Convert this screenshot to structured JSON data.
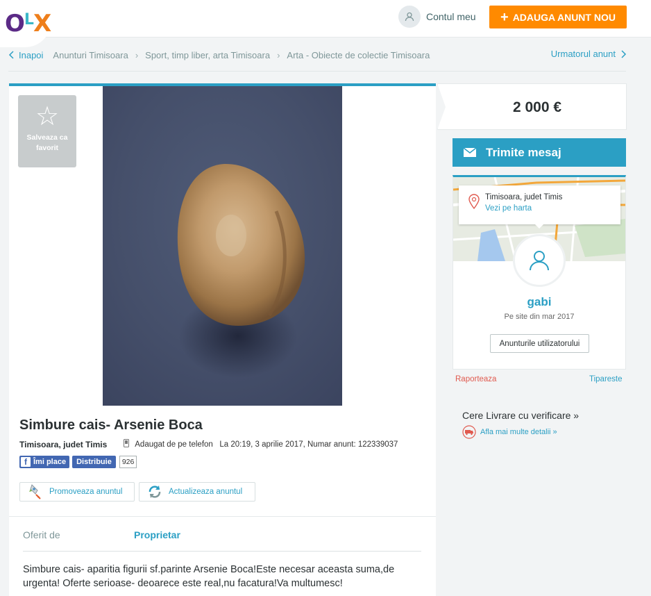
{
  "header": {
    "logo": "OLX",
    "account_label": "Contul meu",
    "add_button_label": "ADAUGA ANUNT NOU",
    "add_button_icon": "plus-icon"
  },
  "breadcrumb": {
    "back_label": "Inapoi",
    "items": [
      "Anunturi Timisoara",
      "Sport, timp liber, arta Timisoara",
      "Arta - Obiecte de colectie Timisoara"
    ],
    "next_label": "Urmatorul anunt"
  },
  "ad": {
    "favorite_label": "Salveaza ca favorit",
    "title": "Simbure cais- Arsenie Boca",
    "location": "Timisoara, judet Timis",
    "added_text": "Adaugat de pe telefon   La 20:19, 3 aprilie 2017, Numar anunt: 122339037",
    "fb_like_label": "Îmi place",
    "fb_share_label": "Distribuie",
    "share_count": "926",
    "promote_label": "Promoveaza anuntul",
    "refresh_label": "Actualizeaza anuntul",
    "offered_by_key": "Oferit de",
    "offered_by_value": "Proprietar",
    "description": "Simbure cais- aparitia figurii sf.parinte Arsenie Boca!Este necesar aceasta suma,de urgenta! Oferte serioase- deoarece este real,nu facatura!Va multumesc!"
  },
  "sidebar": {
    "price": "2 000 €",
    "message_button_label": "Trimite mesaj",
    "map_city": "Timisoara, judet Timis",
    "map_link": "Vezi pe harta",
    "seller_name": "gabi",
    "seller_since": "Pe site din mar 2017",
    "user_ads_button": "Anunturile utilizatorului",
    "report_label": "Raporteaza",
    "print_label": "Tipareste",
    "delivery_title": "Cere Livrare cu verificare »",
    "delivery_more": "Afla mai multe detalii »"
  },
  "colors": {
    "accent": "#2b9fc4",
    "orange": "#ff8a00",
    "report": "#e05a4f",
    "facebook": "#4267b2"
  }
}
